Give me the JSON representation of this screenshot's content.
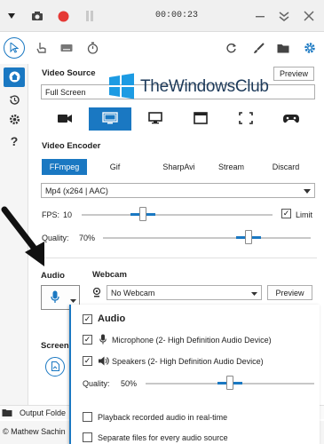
{
  "titlebar": {
    "timer": "00:00:23",
    "icons": [
      "camera-icon",
      "record-icon",
      "pause-icon",
      "minimize-icon",
      "collapse-icon",
      "close-icon"
    ],
    "record_color": "#e53935"
  },
  "toolbar": {
    "icons": [
      "cursor-icon",
      "click-icon",
      "keyboard-icon",
      "timer-icon",
      "refresh-icon",
      "brush-icon",
      "folder-icon",
      "settings-icon"
    ]
  },
  "sidebar": {
    "icons": [
      "home-icon",
      "history-icon",
      "settings-icon",
      "help-icon"
    ],
    "help_label": "?"
  },
  "video_source": {
    "title": "Video Source",
    "preview_label": "Preview",
    "value": "Full Screen",
    "active_index": 1,
    "tiles": [
      "camera-icon",
      "screen-icon",
      "monitor-icon",
      "window-icon",
      "region-icon",
      "gamepad-icon"
    ]
  },
  "watermark": {
    "text": "TheWindowsClub"
  },
  "video_encoder": {
    "title": "Video Encoder",
    "tabs": [
      "FFmpeg",
      "Gif",
      "SharpAvi",
      "Stream",
      "Discard"
    ],
    "active_tab": 0,
    "codec": "Mp4 (x264 | AAC)",
    "fps_label": "FPS:",
    "fps_value": "10",
    "fps_level": 0.32,
    "limit_label": "Limit",
    "limit_checked": true,
    "quality_label": "Quality:",
    "quality_value": "70%",
    "quality_level": 0.7
  },
  "audio": {
    "title": "Audio",
    "icon": "microphone-icon"
  },
  "webcam": {
    "title": "Webcam",
    "value": "No Webcam",
    "preview_label": "Preview"
  },
  "screenshot": {
    "title_partial": "Screens"
  },
  "audio_popup": {
    "title": "Audio",
    "enabled": true,
    "mic_label": "Microphone (2- High Definition Audio Device)",
    "speakers_label": "Speakers (2- High Definition Audio Device)",
    "quality_label": "Quality:",
    "quality_value": "50%",
    "quality_level": 0.5,
    "playback_label": "Playback recorded audio in real-time",
    "separate_label": "Separate files for every audio source"
  },
  "bottom": {
    "output_label": "Output Folde",
    "more_label": "•••"
  },
  "footer": {
    "text": "© Mathew Sachin"
  },
  "colors": {
    "accent": "#1a78c2",
    "record": "#e53935"
  }
}
